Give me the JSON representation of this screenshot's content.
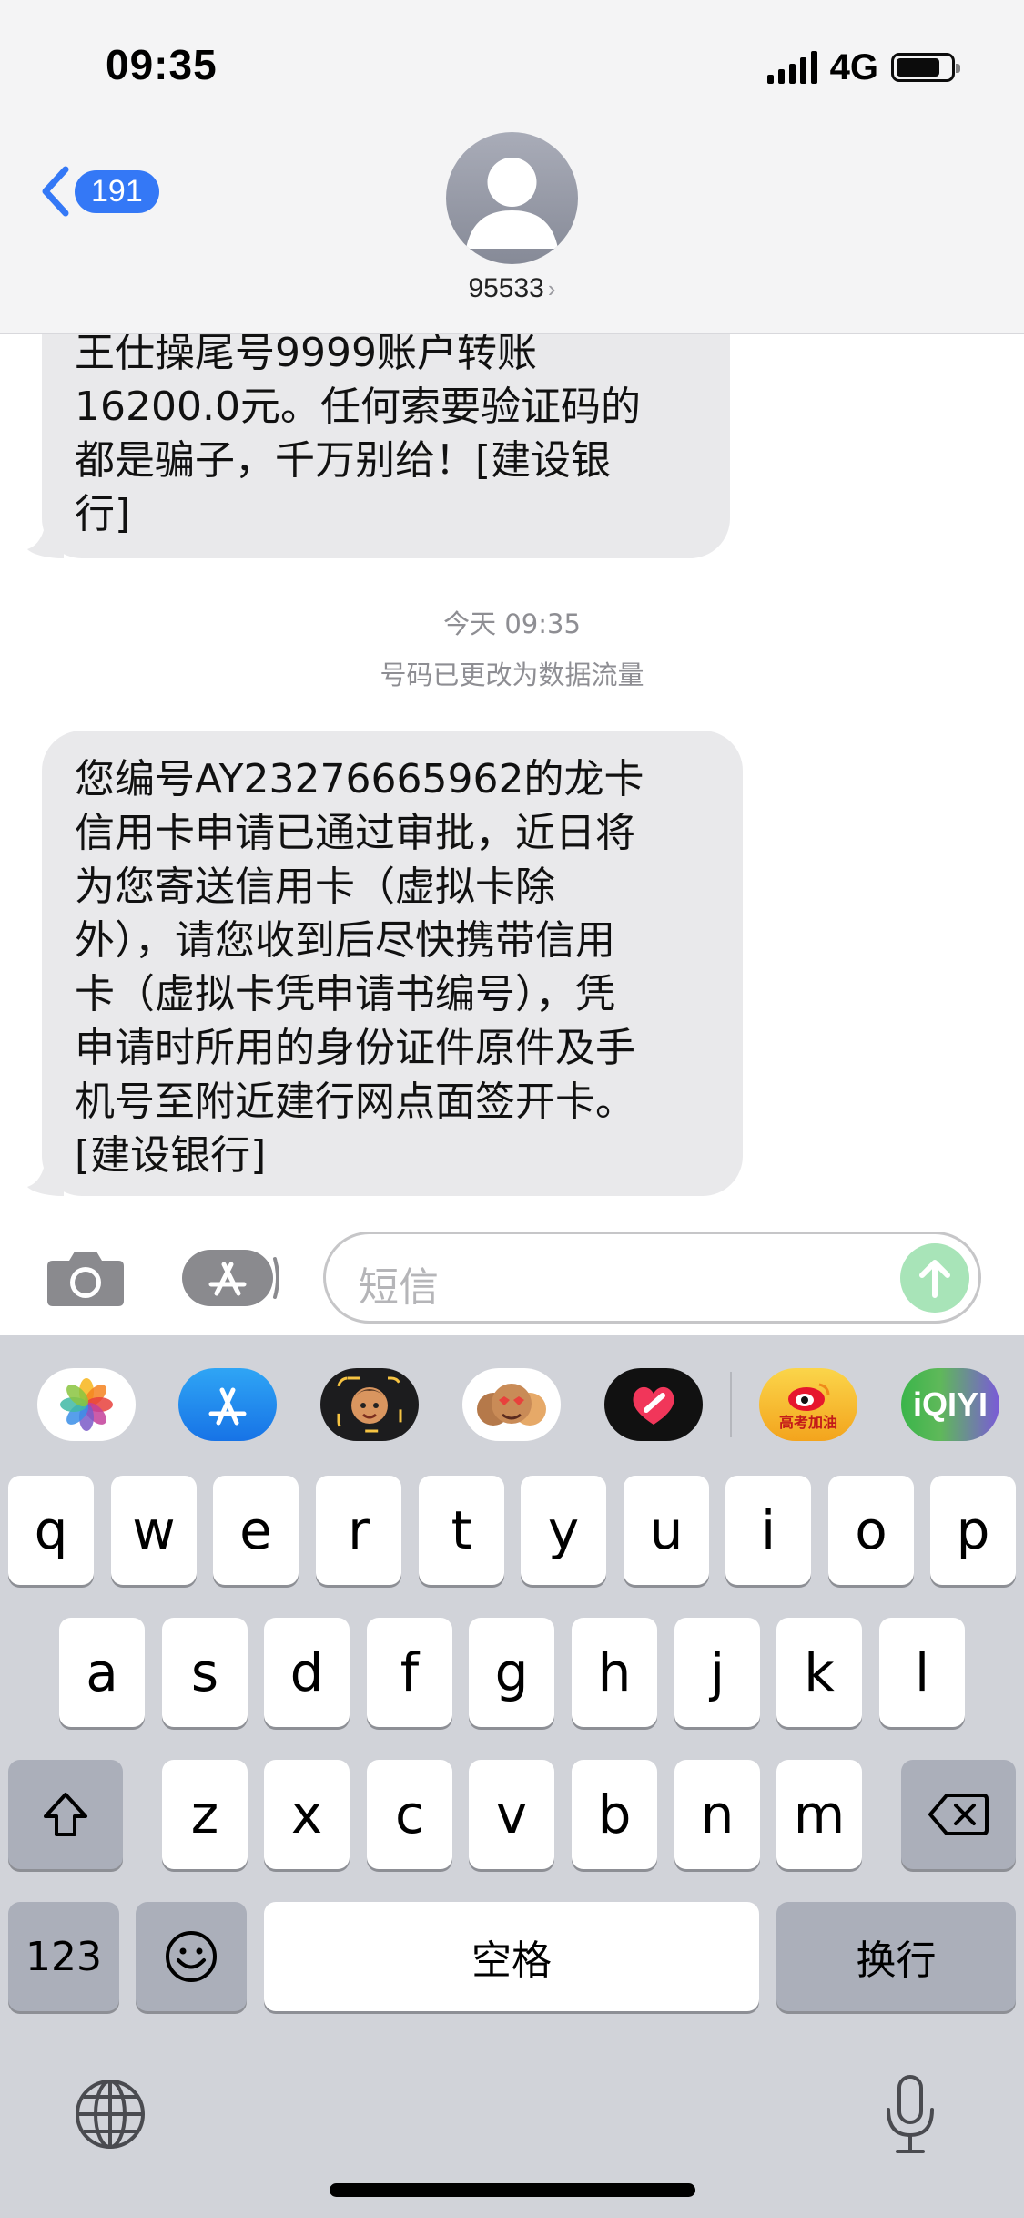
{
  "status_bar": {
    "time": "09:35",
    "network": "4G"
  },
  "header": {
    "back_count": "191",
    "contact": "95533"
  },
  "messages": [
    {
      "text": "王仕操尾号9999账户转账\n16200.0元。任何索要验证码的\n都是骗子，千万别给！[建设银\n行]"
    },
    {
      "text": "您编号AY23276665962的龙卡\n信用卡申请已通过审批，近日将\n为您寄送信用卡（虚拟卡除\n外），请您收到后尽快携带信用\n卡（虚拟卡凭申请书编号），凭\n申请时所用的身份证件原件及手\n机号至附近建行网点面签开卡。\n[建设银行]"
    }
  ],
  "date_label": {
    "day": "今天",
    "time": "09:35"
  },
  "notice": "号码已更改为数据流量",
  "composer": {
    "placeholder": "短信"
  },
  "app_strip": {
    "apps": [
      "photos-app",
      "app-store-app",
      "memoji-app",
      "animoji-app",
      "digital-touch-app",
      "weibo-app",
      "iqiyi-app"
    ],
    "weibo_badge": "高考加油",
    "iqiyi_label": "iQIYI"
  },
  "keyboard": {
    "row1": [
      "q",
      "w",
      "e",
      "r",
      "t",
      "y",
      "u",
      "i",
      "o",
      "p"
    ],
    "row2": [
      "a",
      "s",
      "d",
      "f",
      "g",
      "h",
      "j",
      "k",
      "l"
    ],
    "row3": [
      "z",
      "x",
      "c",
      "v",
      "b",
      "n",
      "m"
    ],
    "numbers_key": "123",
    "space_key": "空格",
    "return_key": "换行"
  },
  "colors": {
    "accent": "#3478f6",
    "bubble": "#e9e9eb",
    "send": "#a8e4b8",
    "keyboard_bg": "#d1d3d9"
  }
}
